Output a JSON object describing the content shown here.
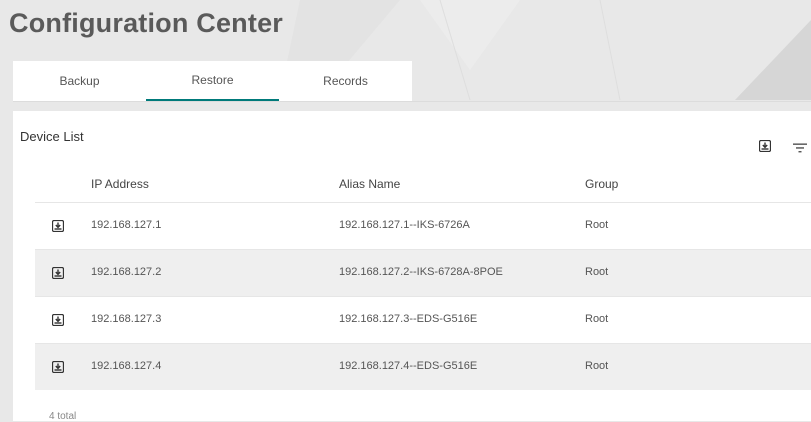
{
  "page_title": "Configuration Center",
  "tabs": [
    {
      "label": "Backup",
      "active": false
    },
    {
      "label": "Restore",
      "active": true
    },
    {
      "label": "Records",
      "active": false
    }
  ],
  "card": {
    "title": "Device List",
    "toolbar": {
      "export_icon": "download-box-icon",
      "filter_icon": "filter-icon"
    }
  },
  "table": {
    "columns": [
      "IP Address",
      "Alias Name",
      "Group"
    ],
    "rows": [
      {
        "ip": "192.168.127.1",
        "alias": "192.168.127.1--IKS-6726A",
        "group": "Root"
      },
      {
        "ip": "192.168.127.2",
        "alias": "192.168.127.2--IKS-6728A-8POE",
        "group": "Root"
      },
      {
        "ip": "192.168.127.3",
        "alias": "192.168.127.3--EDS-G516E",
        "group": "Root"
      },
      {
        "ip": "192.168.127.4",
        "alias": "192.168.127.4--EDS-G516E",
        "group": "Root"
      }
    ],
    "row_icon": "download-box-icon"
  },
  "footer": {
    "total": "4 total"
  },
  "colors": {
    "accent": "#007a7a",
    "background": "#e8e8e8",
    "row_alt": "#efefef"
  }
}
